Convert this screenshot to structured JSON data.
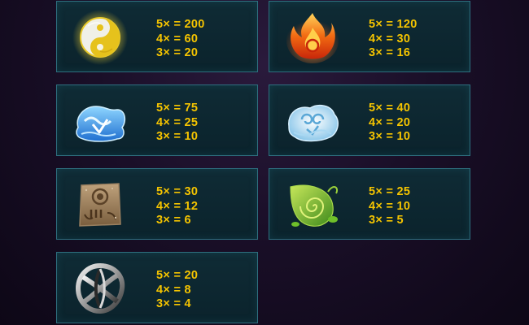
{
  "paytable": [
    {
      "symbol": "yin-yang-icon",
      "pays": [
        "5× = 200",
        "4× = 60",
        "3× = 20"
      ]
    },
    {
      "symbol": "fire-icon",
      "pays": [
        "5× = 120",
        "4× = 30",
        "3× = 16"
      ]
    },
    {
      "symbol": "water-wave-icon",
      "pays": [
        "5× = 75",
        "4× = 25",
        "3× = 10"
      ]
    },
    {
      "symbol": "air-swirl-icon",
      "pays": [
        "5× = 40",
        "4× = 20",
        "3× = 10"
      ]
    },
    {
      "symbol": "earth-stone-icon",
      "pays": [
        "5× = 30",
        "4× = 12",
        "3× = 6"
      ]
    },
    {
      "symbol": "leaf-nature-icon",
      "pays": [
        "5× = 25",
        "4× = 10",
        "3× = 5"
      ]
    },
    {
      "symbol": "metal-knot-icon",
      "pays": [
        "5× = 20",
        "4× = 8",
        "3× = 4"
      ]
    }
  ],
  "colors": {
    "pay_text": "#f5c400",
    "card_border": "#2e6f7f",
    "card_bg": "#0f2b35"
  }
}
